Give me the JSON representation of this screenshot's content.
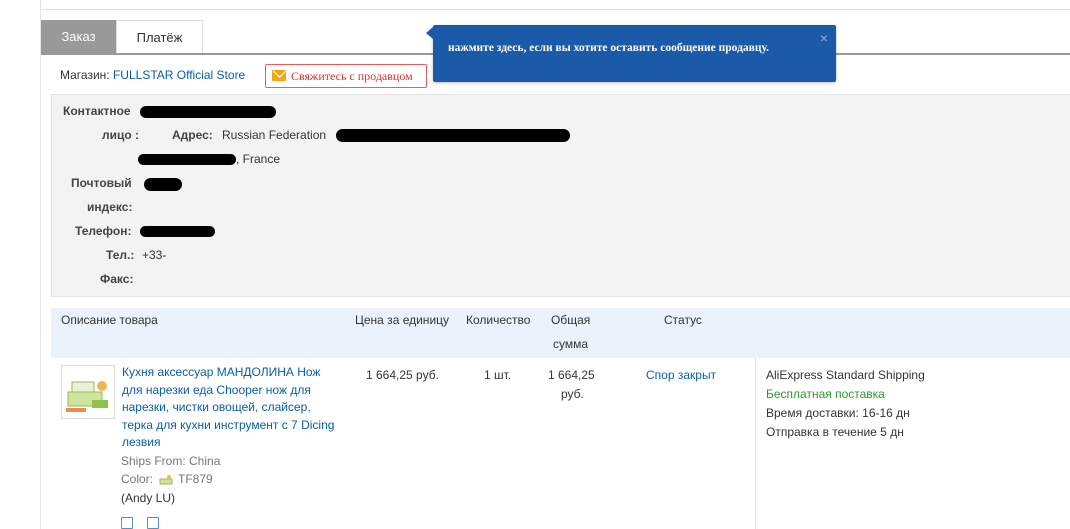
{
  "tabs": {
    "order": "Заказ",
    "payment": "Платёж"
  },
  "store": {
    "label": "Магазин:",
    "name": "FULLSTAR Official Store",
    "contact_button": "Свяжитесь с продавцом"
  },
  "tooltip": {
    "message": "нажмите здесь, если вы хотите оставить сообщение продавцу.",
    "close": "×"
  },
  "address": {
    "contact_label_1": "Контактное",
    "contact_label_2": "лицо :",
    "address_label": "Адрес:",
    "address_value": "Russian Federation",
    "address_line2": ", France",
    "postal_label_1": "Почтовый",
    "postal_label_2": "индекс:",
    "phone_label": "Телефон:",
    "tel_label": "Тел.:",
    "tel_value": "+33-",
    "fax_label": "Факс:"
  },
  "table": {
    "headers": {
      "description": "Описание товара",
      "unit_price": "Цена за единицу",
      "quantity": "Количество",
      "total_1": "Общая",
      "total_2": "сумма",
      "status": "Статус"
    },
    "item": {
      "title": "Кухня аксессуар МАНДОЛИНА Нож для нарезки еда Chooper нож для нарезки, чистки овощей, слайсер, терка для кухни инструмент с 7 Dicing лезвия",
      "ships_from": "Ships From: China",
      "color_label": "Color:",
      "color_value": "TF879",
      "seller": "(Andy LU)",
      "unit_price": "1 664,25 руб.",
      "quantity": "1 шт.",
      "total_1": "1 664,25",
      "total_2": "руб.",
      "status": "Спор закрыт",
      "shipping_method": "AliExpress Standard Shipping",
      "shipping_cost": "Бесплатная поставка",
      "delivery_time": "Время доставки:  16-16 дн",
      "dispatch_time": "Отправка в течение  5 дн"
    }
  },
  "colors": {
    "tab_active": "#999999",
    "link": "#0b5ea8",
    "tooltip": "#1b5aa9",
    "free_shipping": "#2b9a2b",
    "contact_border": "#e06060"
  }
}
